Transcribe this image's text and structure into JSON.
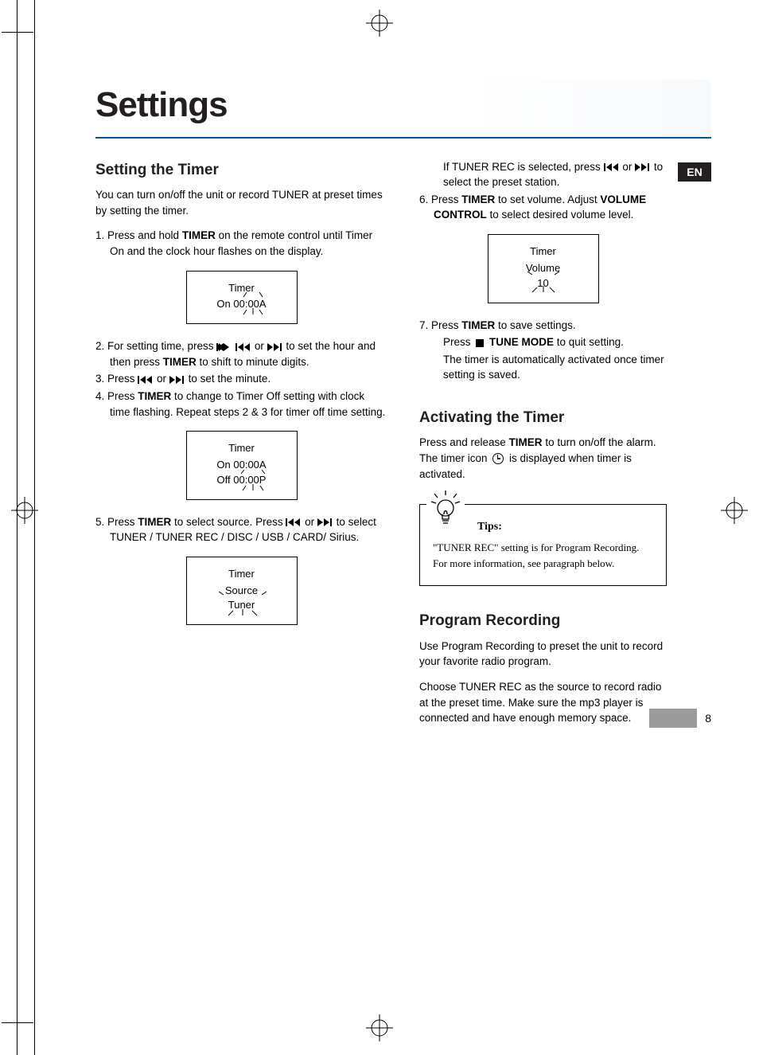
{
  "title": "Settings",
  "lang_flag": "EN",
  "page_number": "8",
  "left": {
    "heading": "Setting the Timer",
    "intro": "You can turn on/off the unit or record TUNER at preset times by setting the timer.",
    "step1_a": "1.  Press and hold ",
    "step1_b": "TIMER",
    "step1_c": " on the remote control until Timer On and the clock hour flashes on the display.",
    "disp1_l1": "Timer",
    "disp1_l2": "On  00:00A",
    "step2_a": "2.  For setting time, press  ",
    "step2_b": "   or   ",
    "step2_c": "    to set the hour and then press ",
    "step2_d": "TIMER",
    "step2_e": " to shift to minute digits.",
    "step3_a": "3.  Press  ",
    "step3_b": "   or   ",
    "step3_c": "    to set the minute.",
    "step4_a": "4.  Press ",
    "step4_b": "TIMER",
    "step4_c": " to change to Timer Off setting with clock time flashing. Repeat steps 2 & 3 for timer off time setting.",
    "disp2_l1": "Timer",
    "disp2_l2": "On  00:00A",
    "disp2_l3": "Off 00:00P",
    "step5_a": "5.  Press ",
    "step5_b": "TIMER",
    "step5_c": " to select source.  Press  ",
    "step5_d": "   or ",
    "step5_e": "   to select TUNER / TUNER REC / DISC / USB / CARD/ Sirius.",
    "disp3_l1": "Timer",
    "disp3_l2": "Source",
    "disp3_l3": "Tuner"
  },
  "right": {
    "r1_a": "If TUNER REC is selected, press  ",
    "r1_b": "   or   ",
    "r1_c": " to select the preset station.",
    "step6_a": "6.  Press ",
    "step6_b": "TIMER",
    "step6_c": " to set volume.  Adjust ",
    "step6_d": "VOLUME CONTROL",
    "step6_e": " to select desired volume level.",
    "disp4_l1": "Timer",
    "disp4_l2": "Volume",
    "disp4_l3": "10",
    "step7_a": "7.  Press ",
    "step7_b": "TIMER",
    "step7_c": "  to save settings.",
    "step7d_a": "Press   ",
    "step7d_b": "  TUNE MODE",
    "step7d_c": " to quit setting.",
    "step7e": "The timer is automatically activated once timer setting is saved.",
    "heading2": "Activating the Timer",
    "act_a": "Press and release ",
    "act_b": "TIMER",
    "act_c": " to turn on/off the alarm. The timer icon  ",
    "act_d": "  is displayed when timer is activated.",
    "tips_label": "Tips:",
    "tips_text": "\"TUNER REC\" setting is for Program Recording. For more information, see paragraph below.",
    "heading3": "Program Recording",
    "pr_intro": "Use Program Recording to preset the unit to record your favorite radio program.",
    "pr_body": "Choose TUNER REC as the source to record radio at the preset time. Make sure the mp3 player is connected and have enough memory space."
  }
}
